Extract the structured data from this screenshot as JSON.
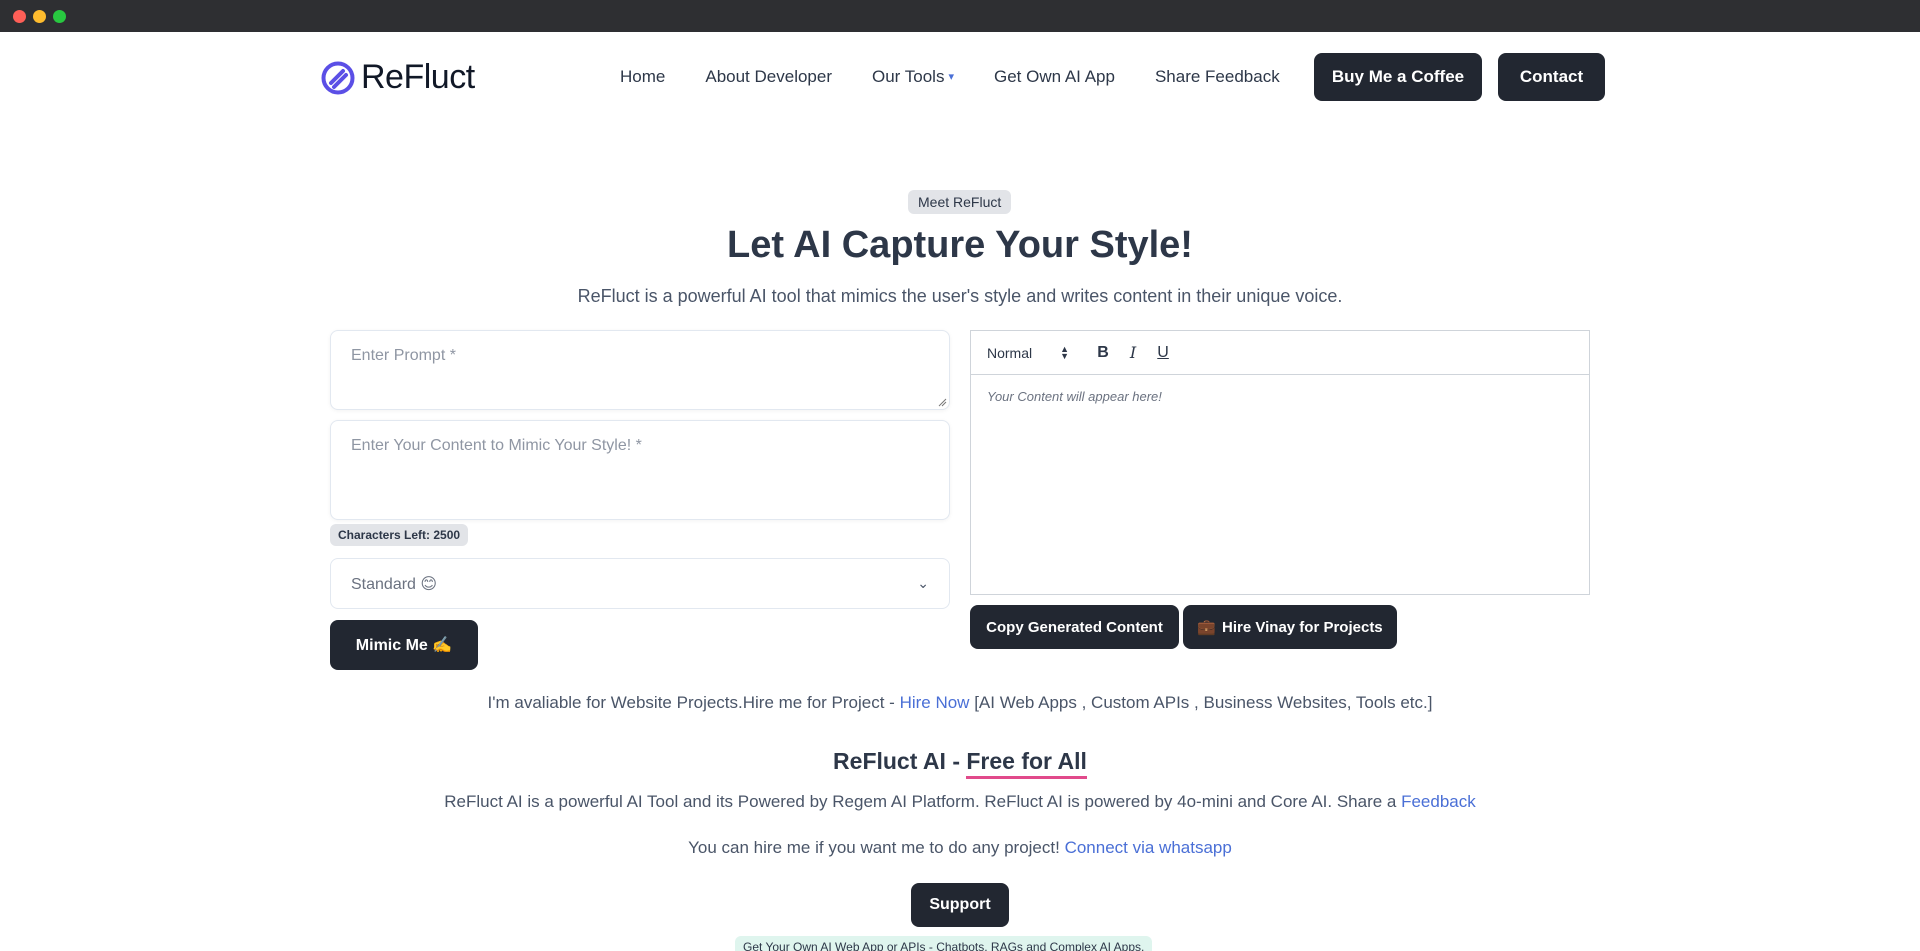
{
  "brand": {
    "name": "ReFluct",
    "logo_color": "#5b4fe6"
  },
  "nav": {
    "home": "Home",
    "about": "About Developer",
    "tools": "Our Tools",
    "own_app": "Get Own AI App",
    "feedback": "Share Feedback",
    "coffee": "Buy Me a Coffee",
    "contact": "Contact"
  },
  "hero": {
    "badge": "Meet ReFluct",
    "title": "Let AI Capture Your Style!",
    "subtitle": "ReFluct is a powerful AI tool that mimics the user's style and writes content in their unique voice."
  },
  "form": {
    "prompt_placeholder": "Enter Prompt *",
    "prompt_value": "",
    "content_placeholder": "Enter Your Content to Mimic Your Style! *",
    "content_value": "",
    "chars_left": "Characters Left: 2500",
    "tone_selected": "Standard 😊",
    "mimic_button": "Mimic Me ✍️"
  },
  "editor": {
    "format": "Normal",
    "bold": "B",
    "italic": "I",
    "underline": "U",
    "placeholder": "Your Content will appear here!"
  },
  "actions": {
    "copy": "Copy Generated Content",
    "hire_icon": "💼",
    "hire": "Hire Vinay for Projects"
  },
  "availability": {
    "text": "I'm avaliable for Website Projects.Hire me for Project - ",
    "link": "Hire Now",
    "suffix": " [AI Web Apps , Custom APIs , Business Websites, Tools etc.]"
  },
  "free": {
    "prefix": "ReFluct AI - ",
    "highlight": "Free for All",
    "highlight_color": "#e14a8b"
  },
  "powered": {
    "text": "ReFluct AI is a powerful AI Tool and its Powered by Regem AI Platform. ReFluct AI is powered by 4o-mini and Core AI. Share a ",
    "link": "Feedback"
  },
  "hireme": {
    "text": "You can hire me if you want me to do any project! ",
    "link": "Connect via whatsapp"
  },
  "support_button": "Support",
  "promo": "Get Your Own AI Web App or APIs - Chatbots, RAGs and Complex AI Apps.",
  "colors": {
    "dark_button": "#222731",
    "link": "#4a6fd6"
  }
}
